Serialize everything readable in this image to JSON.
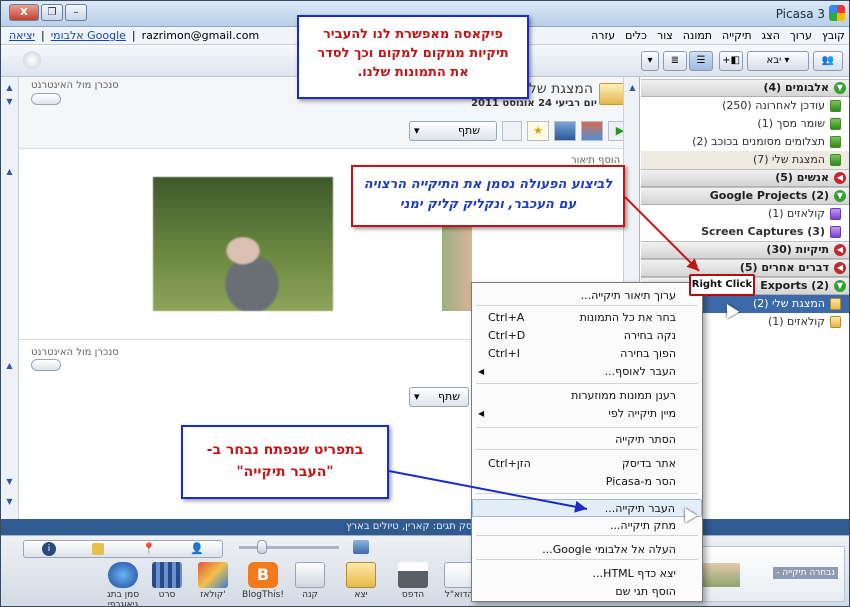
{
  "window": {
    "title": "Picasa 3",
    "minimize": "–",
    "maximize": "❐",
    "close": "X"
  },
  "menubar": {
    "menus": [
      "קובץ",
      "ערוך",
      "הצג",
      "תיקייה",
      "תמונה",
      "צור",
      "כלים",
      "עזרה"
    ],
    "email": "razrimon@gmail.com",
    "web_albums_link": "אלבומי Google",
    "sep": "|",
    "signout_link": "יציאה"
  },
  "toolbar": {
    "import_label": "יבא"
  },
  "folder": {
    "name": "המצגת שלי",
    "date": "יום רביעי 24 אוגוסט 2011",
    "add_caption": "הוסף תיאור",
    "share_label": "שתף",
    "sync_label": "סנכרן מול האינטרנט"
  },
  "left_panel": {
    "groups": [
      {
        "label": "אלבומים (4)",
        "state": "open"
      },
      {
        "label": "אנשים (5)",
        "state": "closed"
      },
      {
        "label": "Google Projects (2)",
        "state": "open"
      },
      {
        "label": "תיקיות (30)",
        "state": "closed"
      },
      {
        "label": "דברים אחרים (5)",
        "state": "closed"
      },
      {
        "label": "Exports (2)",
        "state": "open"
      }
    ],
    "items": {
      "albums": [
        "עודכן לאחרונה (250)",
        "שומר מסך (1)",
        "תצלומים מסומנים בכוכב (2)",
        "המצגת שלי (7)"
      ],
      "google_projects": [
        "קולאזים (1)",
        "Screen Captures (3)"
      ],
      "exports": [
        "המצגת שלי (2)",
        "קולאזים (1)"
      ]
    }
  },
  "context_menu": {
    "items": [
      {
        "label": "ערוך תיאור תיקייה...",
        "shortcut": ""
      },
      {
        "label": "בחר את כל התמונות",
        "shortcut": "Ctrl+A"
      },
      {
        "label": "נקה בחירה",
        "shortcut": "Ctrl+D"
      },
      {
        "label": "הפוך בחירה",
        "shortcut": "Ctrl+I"
      },
      {
        "label": "העבר לאוסף...",
        "shortcut": ""
      },
      {
        "label": "רענן תמונות ממוזערות",
        "shortcut": ""
      },
      {
        "label": "מיין תיקייה לפי",
        "shortcut": ""
      },
      {
        "label": "הסתר תיקייה",
        "shortcut": ""
      },
      {
        "label": "אתר בדיסק",
        "shortcut": "Ctrl+הזן"
      },
      {
        "label": "הסר מ-Picasa",
        "shortcut": ""
      },
      {
        "label": "העבר תיקייה...",
        "shortcut": ""
      },
      {
        "label": "מחק תיקייה...",
        "shortcut": ""
      },
      {
        "label": "העלה אל אלבומי Google...",
        "shortcut": ""
      },
      {
        "label": "יצא כדף HTML...",
        "shortcut": ""
      },
      {
        "label": "הוסף תגי שם",
        "shortcut": ""
      }
    ]
  },
  "annotations": {
    "top": "פיקאסה מאפשרת לנו להעביר תיקיות ממקום למקום וכך לסדר את התמונות שלנו.",
    "middle": "לביצוע הפעולה נסמן את התיקייה הרצויה עם העכבר, ונקליק קליק ימני",
    "bottom": "בתפריט שנפתח נבחר ב-\"העבר תיקייה\"",
    "right_click": "Right Click"
  },
  "status_bar": {
    "text": "יום ראשון 26 יוני 2011   78KB בדיסק   תגים: קארין, טיולים בארץ"
  },
  "tray": {
    "buttons": [
      "הדוא\"ל",
      "הדפס",
      "יצא",
      "קנה",
      "BlogThis!",
      "קולאז'",
      "סרט",
      "סמן בתג גיאוגרפי"
    ],
    "selected_label": "נבחרה תיקייה -"
  },
  "colors": {
    "accent_blue": "#1a2bc9",
    "annotation_red": "#c31515",
    "status_bar": "#2f5b91",
    "selection": "#3c6aa8"
  }
}
